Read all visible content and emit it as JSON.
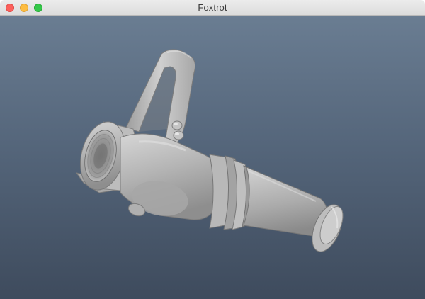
{
  "window": {
    "title": "Foxtrot",
    "controls": [
      "close",
      "minimize",
      "zoom"
    ]
  },
  "viewport": {
    "model": "fire-hose-nozzle",
    "background_top": "#6a7d92",
    "background_bottom": "#3e4b5d",
    "model_color": "#b7b7b7"
  }
}
